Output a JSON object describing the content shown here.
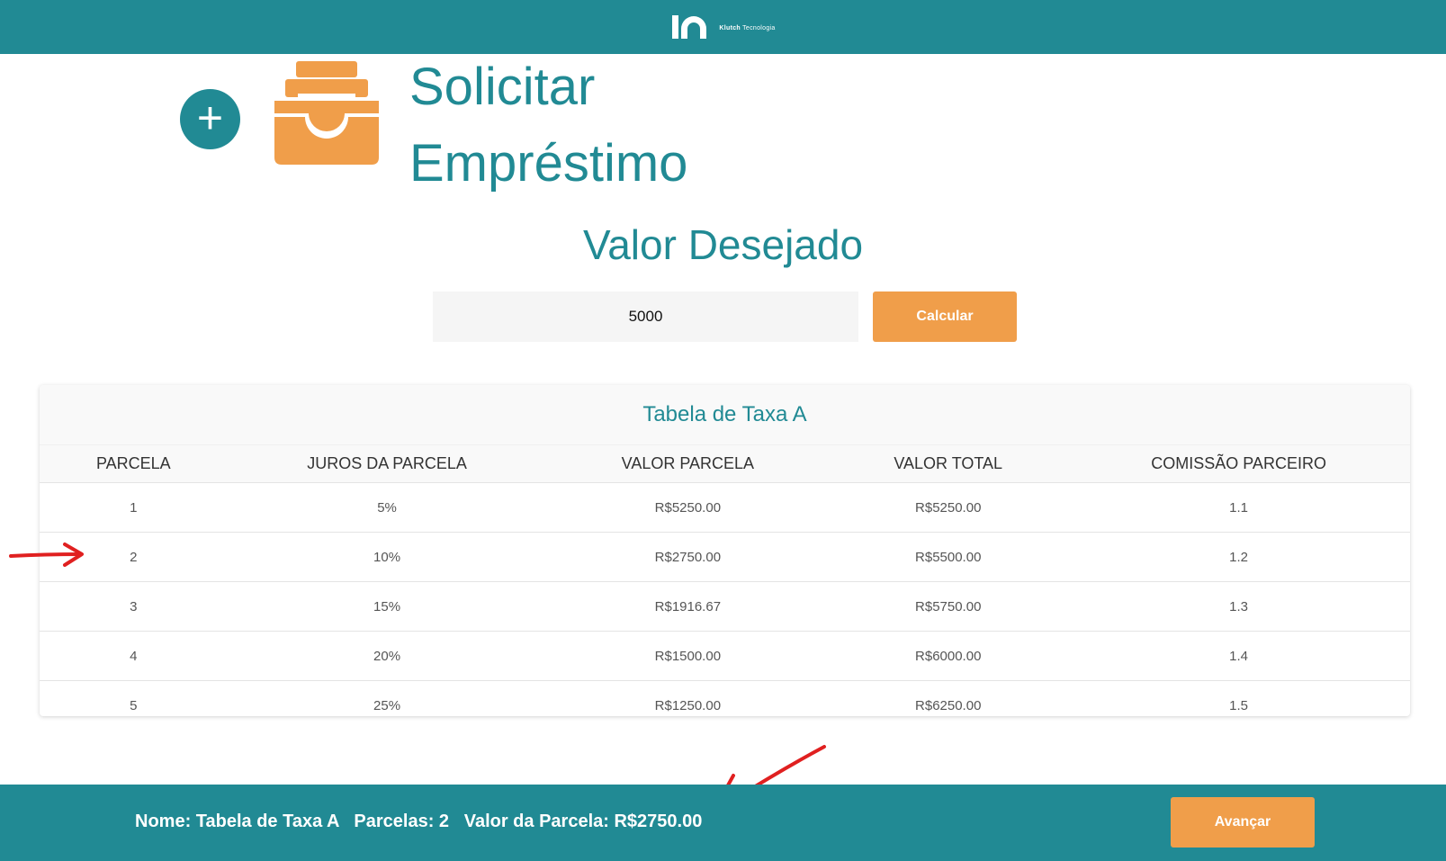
{
  "header": {
    "logo_text": "Klutch",
    "logo_subtext": "Tecnologia"
  },
  "page": {
    "title_line1": "Solicitar",
    "title_line2": "Empréstimo"
  },
  "form": {
    "title": "Valor Desejado",
    "value": "5000",
    "calculate_label": "Calcular"
  },
  "rate_table": {
    "title": "Tabela de Taxa A",
    "columns": [
      "PARCELA",
      "JUROS DA PARCELA",
      "VALOR PARCELA",
      "VALOR TOTAL",
      "COMISSÃO PARCEIRO"
    ],
    "rows": [
      [
        "1",
        "5%",
        "R$5250.00",
        "R$5250.00",
        "1.1"
      ],
      [
        "2",
        "10%",
        "R$2750.00",
        "R$5500.00",
        "1.2"
      ],
      [
        "3",
        "15%",
        "R$1916.67",
        "R$5750.00",
        "1.3"
      ],
      [
        "4",
        "20%",
        "R$1500.00",
        "R$6000.00",
        "1.4"
      ],
      [
        "5",
        "25%",
        "R$1250.00",
        "R$6250.00",
        "1.5"
      ]
    ]
  },
  "footer": {
    "summary": "Nome: Tabela de Taxa A   Parcelas: 2   Valor da Parcela: R$2750.00",
    "next_label": "Avançar"
  },
  "colors": {
    "primary": "#218a94",
    "accent": "#f09e4a",
    "annotation": "#e02020"
  },
  "icons": {
    "add": "plus-icon",
    "archive": "archive-box-icon"
  }
}
